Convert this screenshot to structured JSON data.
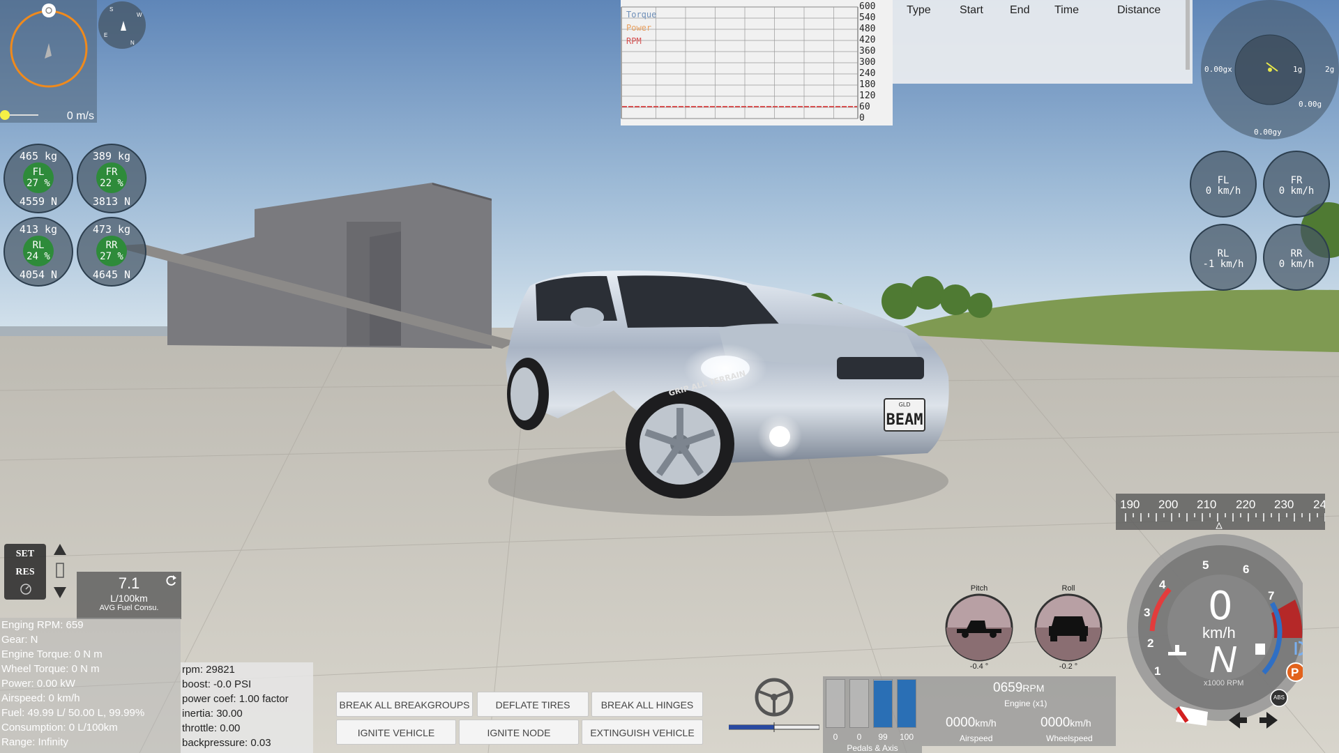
{
  "speed_panel": {
    "speed": "0 m/s",
    "compass": {
      "s": "S",
      "w": "W",
      "e": "E",
      "n": "N"
    }
  },
  "tires": [
    {
      "id": "FL",
      "kg": "465  kg",
      "label": "FL",
      "pct": "27 %",
      "n": "4559  N"
    },
    {
      "id": "FR",
      "kg": "389  kg",
      "label": "FR",
      "pct": "22 %",
      "n": "3813  N"
    },
    {
      "id": "RL",
      "kg": "413  kg",
      "label": "RL",
      "pct": "24 %",
      "n": "4054  N"
    },
    {
      "id": "RR",
      "kg": "473  kg",
      "label": "RR",
      "pct": "27 %",
      "n": "4645  N"
    }
  ],
  "graph": {
    "legend": [
      {
        "name": "Torque",
        "color": "#6f8fb8"
      },
      {
        "name": "Power",
        "color": "#e8a060"
      },
      {
        "name": "RPM",
        "color": "#d65050"
      }
    ],
    "y_ticks": [
      "600",
      "540",
      "480",
      "420",
      "360",
      "300",
      "240",
      "180",
      "120",
      "60",
      "0"
    ]
  },
  "timing": {
    "columns": [
      "Type",
      "Start",
      "End",
      "Time",
      "Distance"
    ]
  },
  "gmeter": {
    "gx": "0.00gx",
    "one_g": "1g",
    "two_g": "2g",
    "g": "0.00g",
    "gy": "0.00gy"
  },
  "wheel_speeds": [
    {
      "id": "FL",
      "label": "FL",
      "value": "0  km/h"
    },
    {
      "id": "FR",
      "label": "FR",
      "value": "0  km/h"
    },
    {
      "id": "RL",
      "label": "RL",
      "value": "-1  km/h"
    },
    {
      "id": "RR",
      "label": "RR",
      "value": "0  km/h"
    }
  ],
  "cruise": {
    "set": "SET",
    "res": "RES"
  },
  "fuel": {
    "value": "7.1",
    "unit": "L/100km",
    "caption": "AVG Fuel Consu."
  },
  "info_left": [
    "Enging RPM: 659",
    "Gear: N",
    "Engine Torque: 0 N m",
    "Wheel Torque: 0 N m",
    "Power: 0.00 kW",
    "Airspeed: 0 km/h",
    "Fuel: 49.99 L/ 50.00 L, 99.99%",
    "Consumption: 0 L/100km",
    "Range: Infinity"
  ],
  "info_right": [
    "rpm: 29821",
    "boost: -0.0 PSI",
    "power coef: 1.00 factor",
    "inertia: 30.00",
    "throttle: 0.00",
    "backpressure: 0.03"
  ],
  "buttons": {
    "break_breakgroups": "BREAK ALL BREAKGROUPS",
    "deflate_tires": "DEFLATE TIRES",
    "break_hinges": "BREAK ALL HINGES",
    "ignite_vehicle": "IGNITE VEHICLE",
    "ignite_node": "IGNITE NODE",
    "extinguish_vehicle": "EXTINGUISH VEHICLE"
  },
  "steering": {
    "fraction": 0.5
  },
  "pitch_roll": {
    "pitch_label": "Pitch",
    "pitch_value": "-0.4 °",
    "roll_label": "Roll",
    "roll_value": "-0.2 °"
  },
  "pedals": {
    "caption": "Pedals & Axis",
    "bars": [
      {
        "label": "0",
        "level": 0
      },
      {
        "label": "0",
        "level": 0
      },
      {
        "label": "99",
        "level": 99
      },
      {
        "label": "100",
        "level": 100
      }
    ]
  },
  "engine": {
    "rpm": "0659",
    "rpm_unit": "RPM",
    "engine_label": "Engine (x1)",
    "airspeed": "0000",
    "airspeed_unit": "km/h",
    "airspeed_label": "Airspeed",
    "wheelspeed": "0000",
    "wheelspeed_unit": "km/h",
    "wheelspeed_label": "Wheelspeed"
  },
  "ruler": {
    "ticks": [
      "190",
      "200",
      "210",
      "220",
      "230",
      "24"
    ]
  },
  "speedo": {
    "speed": "0",
    "unit": "km/h",
    "gear": "N",
    "rpm_caption": "x1000 RPM",
    "ticks": [
      "1",
      "2",
      "3",
      "4",
      "5",
      "6",
      "7"
    ],
    "parking": "P",
    "abs": "ABS"
  },
  "plate": {
    "small": "GLD",
    "text": "BEAM"
  },
  "tire_text": "GRIP ALL TERRAIN",
  "colors": {
    "sky_top": "#6f93c0",
    "ground": "#cfccc4",
    "accent_orange": "#f08a1c",
    "tire_green": "#2e8b3a",
    "bar_blue": "#2a6fb5"
  }
}
